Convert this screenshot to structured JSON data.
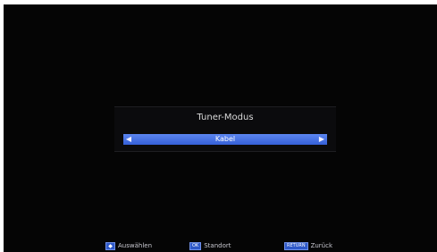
{
  "dialog": {
    "title": "Tuner-Modus",
    "value": "Kabel",
    "left_arrow": "◀",
    "right_arrow": "▶"
  },
  "footer": {
    "hints": [
      {
        "key": "◆",
        "label": "Auswählen",
        "key_icon": "navigation-keys-icon"
      },
      {
        "key": "OK",
        "label": "Standort"
      },
      {
        "key": "RETURN",
        "label": "Zurück"
      }
    ]
  },
  "colors": {
    "background": "#050505",
    "selector": "#4a74e6",
    "key": "#2e58c8",
    "text": "#d9d9d9"
  }
}
